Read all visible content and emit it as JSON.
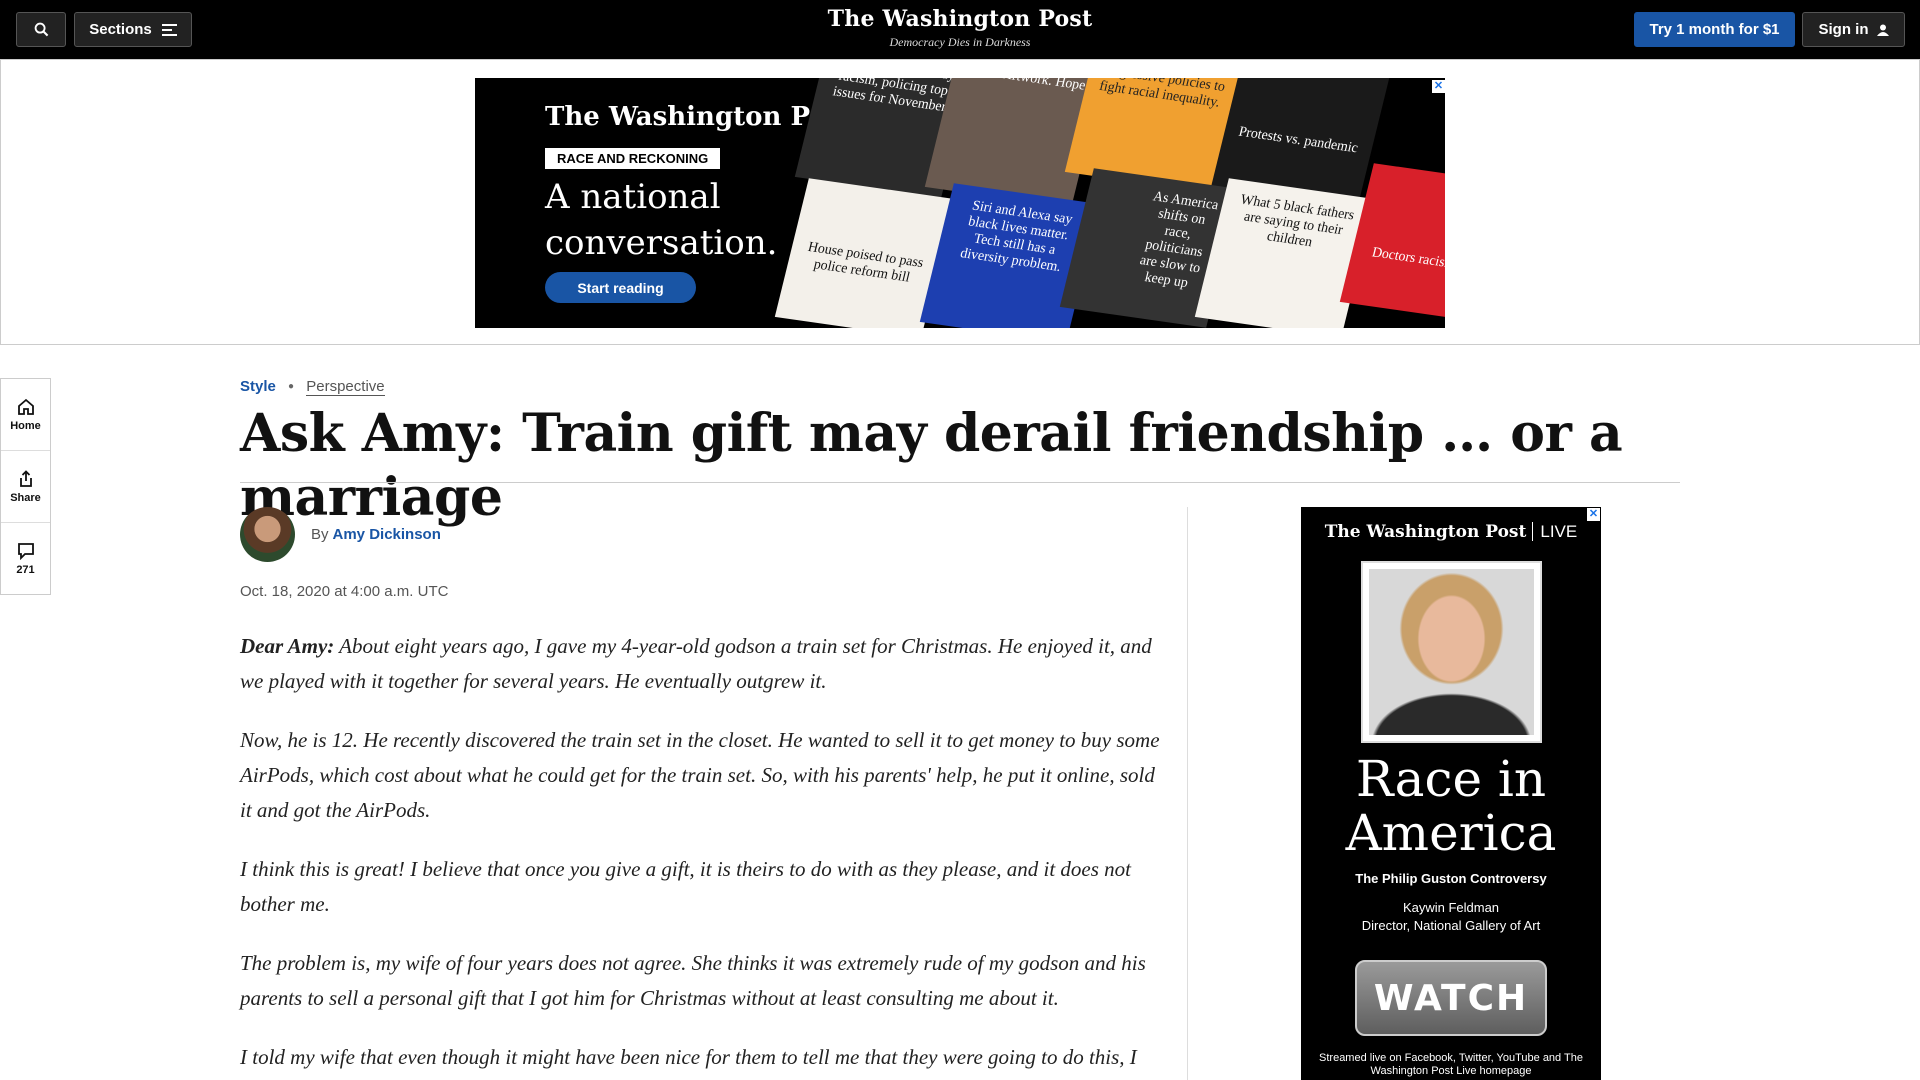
{
  "header": {
    "search_icon": "search-icon",
    "sections_label": "Sections",
    "logo": "The Washington Post",
    "tagline": "Democracy Dies in Darkness",
    "trial_label": "Try 1 month for $1",
    "signin_label": "Sign in"
  },
  "top_ad": {
    "logo": "The Washington Post",
    "badge": "RACE AND RECKONING",
    "headline": "A national conversation.",
    "cta": "Start reading",
    "tiles": [
      "Black Americans say racism, policing top issues for November",
      "Signs. Artwork. Hope.",
      "Minneapolis enacted progressive policies to fight racial inequality.",
      "Protests vs. pandemic",
      "House poised to pass police reform bill",
      "Siri and Alexa say black lives matter. Tech still has a diversity problem.",
      "As America shifts on race, politicians are slow to keep up",
      "What 5 black fathers are saying to their children",
      "Doctors racism in h"
    ]
  },
  "rail": {
    "items": [
      {
        "label": "Home",
        "icon": "home-icon"
      },
      {
        "label": "Share",
        "icon": "share-icon"
      },
      {
        "label": "271",
        "icon": "comment-icon"
      }
    ]
  },
  "article": {
    "section": "Style",
    "label": "Perspective",
    "headline": "Ask Amy: Train gift may derail friendship … or a marriage",
    "byline_prefix": "By",
    "author": "Amy Dickinson",
    "date": "Oct. 18, 2020 at 4:00 a.m. UTC",
    "lead_in": "Dear Amy:",
    "paragraphs": [
      "About eight years ago, I gave my 4-year-old godson a train set for Christmas. He enjoyed it, and we played with it together for several years. He eventually outgrew it.",
      "Now, he is 12. He recently discovered the train set in the closet. He wanted to sell it to get money to buy some AirPods, which cost about what he could get for the train set. So, with his parents' help, he put it online, sold it and got the AirPods.",
      "I think this is great! I believe that once you give a gift, it is theirs to do with as they please, and it does not bother me.",
      "The problem is, my wife of four years does not agree. She thinks it was extremely rude of my godson and his parents to sell a personal gift that I got him for Christmas without at least consulting me about it.",
      "I told my wife that even though it might have been nice for them to tell me that they were going to do this, I"
    ]
  },
  "side_ad": {
    "logo": "The Washington Post",
    "live": "LIVE",
    "title": "Race in America",
    "subtitle": "The Philip Guston Controversy",
    "guest_name": "Kaywin Feldman",
    "guest_title": "Director, National Gallery of Art",
    "watch": "WATCH",
    "footer": "Streamed live on Facebook, Twitter, YouTube and The Washington Post Live homepage"
  }
}
